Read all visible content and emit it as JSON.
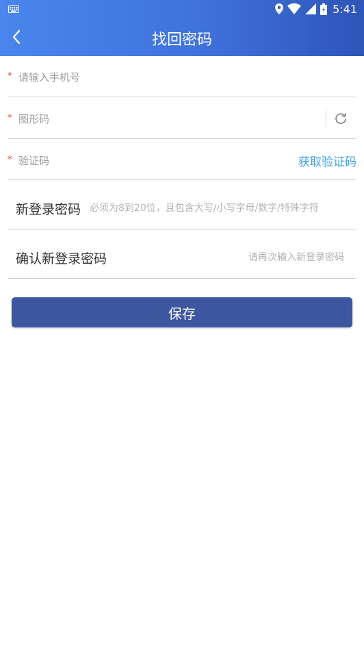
{
  "status_bar": {
    "time": "5:41",
    "icons": [
      "keyboard-icon",
      "location-icon",
      "wifi-icon",
      "signal-icon",
      "battery-icon"
    ]
  },
  "header": {
    "title": "找回密码",
    "back_icon": "back-arrow-icon"
  },
  "form": {
    "phone": {
      "required_mark": "*",
      "placeholder": "请输入手机号"
    },
    "captcha": {
      "required_mark": "*",
      "placeholder": "图形码",
      "refresh_icon": "refresh-icon"
    },
    "sms_code": {
      "required_mark": "*",
      "placeholder": "验证码",
      "get_code_label": "获取验证码"
    },
    "new_password": {
      "label": "新登录密码",
      "placeholder": "必须为8到20位，且包含大写/小写字母/数字/特殊字符"
    },
    "confirm_password": {
      "label": "确认新登录密码",
      "placeholder": "请再次输入新登录密码"
    },
    "save_label": "保存"
  },
  "colors": {
    "header_start": "#4a86ee",
    "header_end": "#2f55b8",
    "accent_link": "#3d9fe8",
    "save_button": "#3d56a0",
    "required": "#e53935"
  }
}
